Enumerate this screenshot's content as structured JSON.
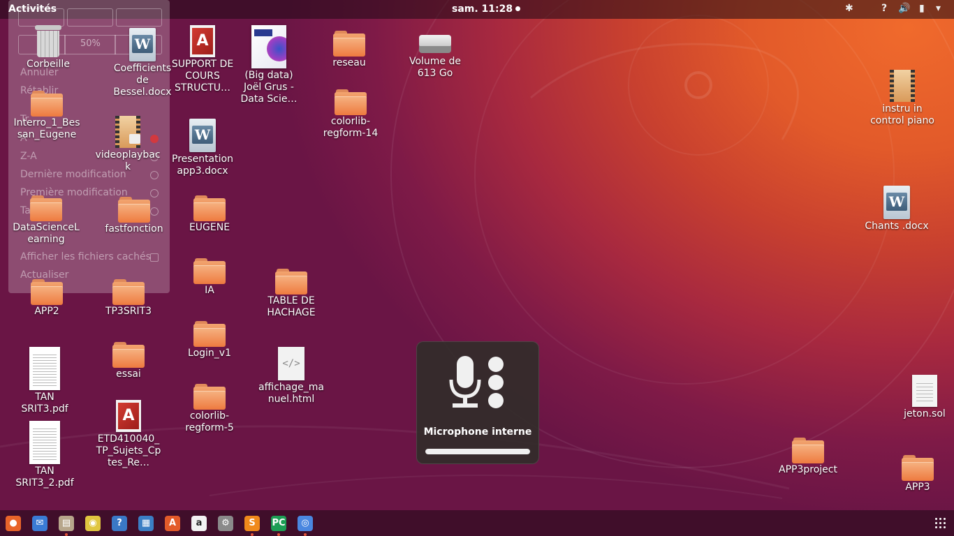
{
  "topbar": {
    "activities": "Activités",
    "clock": "sam. 11:28",
    "tray_icons": [
      "bluetooth-icon",
      "help-icon",
      "volume-icon",
      "battery-icon",
      "system-menu-icon"
    ],
    "tray_glyphs": [
      "✱",
      "?",
      "🔊",
      "▮",
      "▾"
    ]
  },
  "context_menu": {
    "zoom_level": "50%",
    "items": [
      "Annuler",
      "Rétablir",
      "Tr",
      "A",
      "Z-A",
      "Dernière modification",
      "Première modification",
      "Taille",
      "Afficher les fichiers cachés",
      "Actualiser"
    ]
  },
  "desktop": {
    "icons": [
      {
        "label": "Corbeille",
        "kind": "trash"
      },
      {
        "label": "Coefficients de Bessel.docx",
        "kind": "word"
      },
      {
        "label": "SUPPORT DE COURS STRUCTU…",
        "kind": "pdf"
      },
      {
        "label": "(Big data) Joël Grus - Data Scie…",
        "kind": "book"
      },
      {
        "label": "reseau",
        "kind": "folder"
      },
      {
        "label": "Volume de 613 Go",
        "kind": "disk"
      },
      {
        "label": "instru in control piano",
        "kind": "video"
      },
      {
        "label": "colorlib-regform-14",
        "kind": "folder"
      },
      {
        "label": "Interro_1_Bessan_Eugene",
        "kind": "folder"
      },
      {
        "label": "videoplayback",
        "kind": "video-locked"
      },
      {
        "label": "Presentation app3.docx",
        "kind": "word"
      },
      {
        "label": "Chants .docx",
        "kind": "word"
      },
      {
        "label": "DataScienceLearning",
        "kind": "folder"
      },
      {
        "label": "fastfonction",
        "kind": "folder"
      },
      {
        "label": "EUGENE",
        "kind": "folder"
      },
      {
        "label": "IA",
        "kind": "folder"
      },
      {
        "label": "TABLE DE HACHAGE",
        "kind": "folder"
      },
      {
        "label": "APP2",
        "kind": "folder"
      },
      {
        "label": "TP3SRIT3",
        "kind": "folder"
      },
      {
        "label": "Login_v1",
        "kind": "folder"
      },
      {
        "label": "TAN SRIT3.pdf",
        "kind": "scan"
      },
      {
        "label": "essai",
        "kind": "folder"
      },
      {
        "label": "affichage_manuel.html",
        "kind": "html"
      },
      {
        "label": "jeton.sol",
        "kind": "text"
      },
      {
        "label": "ETD410040_TP_Sujets_Cptes_Re…",
        "kind": "pdf"
      },
      {
        "label": "colorlib-regform-5",
        "kind": "folder"
      },
      {
        "label": "TAN SRIT3_2.pdf",
        "kind": "scan"
      },
      {
        "label": "APP3project",
        "kind": "folder"
      },
      {
        "label": "APP3",
        "kind": "folder"
      }
    ]
  },
  "osd": {
    "label": "Microphone interne",
    "level_percent": 100
  },
  "dock": {
    "apps": [
      {
        "name": "firefox",
        "glyph": "●",
        "color": "#e8642a"
      },
      {
        "name": "thunderbird",
        "glyph": "✉",
        "color": "#3a7bd5"
      },
      {
        "name": "files",
        "glyph": "▤",
        "color": "#b7a68b"
      },
      {
        "name": "rhythmbox",
        "glyph": "◉",
        "color": "#e0c640"
      },
      {
        "name": "help",
        "glyph": "?",
        "color": "#3a78c6"
      },
      {
        "name": "writer",
        "glyph": "▦",
        "color": "#3b7fc4"
      },
      {
        "name": "software",
        "glyph": "A",
        "color": "#e35b2a"
      },
      {
        "name": "amazon",
        "glyph": "a",
        "color": "#f2f2f2"
      },
      {
        "name": "settings",
        "glyph": "⚙",
        "color": "#8a8a8a"
      },
      {
        "name": "sublime-text",
        "glyph": "S",
        "color": "#f08a1b"
      },
      {
        "name": "pycharm",
        "glyph": "PC",
        "color": "#1d9e55"
      },
      {
        "name": "chrome",
        "glyph": "◎",
        "color": "#4a87e0"
      }
    ]
  }
}
